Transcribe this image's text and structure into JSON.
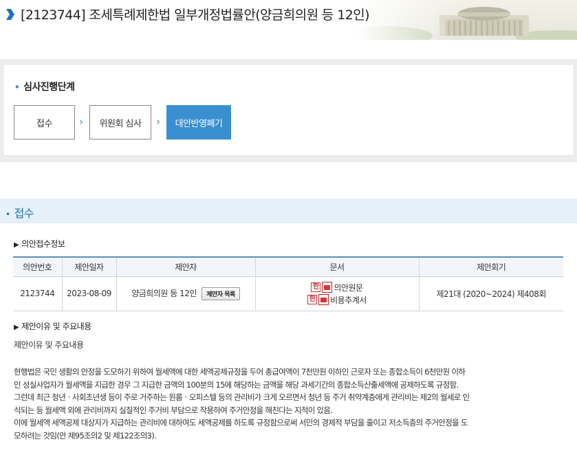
{
  "header": {
    "title": "[2123744] 조세특례제한법 일부개정법률안(양금희의원 등 12인)"
  },
  "stage": {
    "title": "심사진행단계",
    "steps": [
      {
        "label": "접수",
        "active": false
      },
      {
        "label": "위원회 심사",
        "active": false
      },
      {
        "label": "대안반영폐기",
        "active": true
      }
    ]
  },
  "section": {
    "title": "접수",
    "intake_info_label": "의안접수정보",
    "table": {
      "headers": [
        "의안번호",
        "제안일자",
        "제안자",
        "문서",
        "제안회기"
      ],
      "row": {
        "bill_no": "2123744",
        "date": "2023-08-09",
        "proposer": "양금희의원 등 12인",
        "proposer_button": "제안자 목록",
        "docs": [
          "의안원문",
          "비용추계서"
        ],
        "session": "제21대 (2020~2024) 제408회"
      }
    },
    "reason_heading": "제안이유 및 주요내용",
    "reason_label": "제안이유 및 주요내용",
    "reason_text": [
      "현행법은 국민 생활의 안정을 도모하기 위하여 월세액에 대한 세액공제규정을 두어 총급여액이 7천만원 이하인 근로자 또는 종합소득이 6천만원 이하",
      "인 성실사업자가 월세액을 지급한 경우 그 지급한 금액의 100분의 15에 해당하는 금액을 해당 과세기간의 종합소득산출세액에 공제하도록 규정함.",
      "그런데 최근 청년ㆍ사회초년생 등이 주로 거주하는 원룸ㆍ오피스텔 등의 관리비가 크게 오르면서 청년 등 주거 취약계층에게 관리비는 제2의 월세로 인",
      "식되는 등 월세액 외에 관리비까지 실질적인 주거비 부담으로 작용하여 주거안정을 해친다는 지적이 있음.",
      "이에 월세액 세액공제 대상자가 지급하는 관리비에 대하여도 세액공제를 하도록 규정함으로써 서민의 경제적 부담을 줄이고 저소득층의 주거안정을 도",
      "모하려는 것임(안 제95조의2 및 제122조의3)."
    ]
  },
  "colors": {
    "accent": "#3a8fd0",
    "section_bg": "#e5f0f9",
    "section_text": "#1e73be"
  }
}
